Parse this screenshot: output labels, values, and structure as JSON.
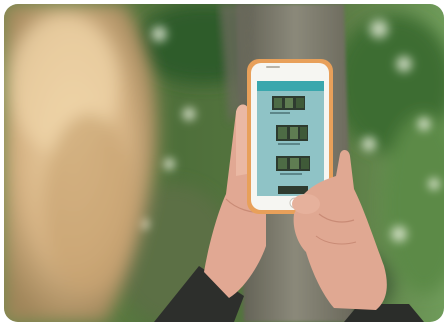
{
  "scene": {
    "subject": "person-holding-smartphone",
    "setting": "forest-trees",
    "colors": {
      "foliage_dark": "#2d5a2a",
      "foliage_light": "#9cc47a",
      "tree_trunk": "#7a7868",
      "hair": "#d9b98c",
      "skin": "#e3ad97",
      "phone_case": "#e8a05a",
      "app_header": "#3aa7ad",
      "app_background": "#8fc3c6",
      "sleeve": "#2d2f2c"
    }
  },
  "phone": {
    "app": {
      "header_title": "",
      "items": [
        {
          "label": ""
        },
        {
          "label": ""
        },
        {
          "label": ""
        },
        {
          "label": ""
        }
      ]
    }
  }
}
